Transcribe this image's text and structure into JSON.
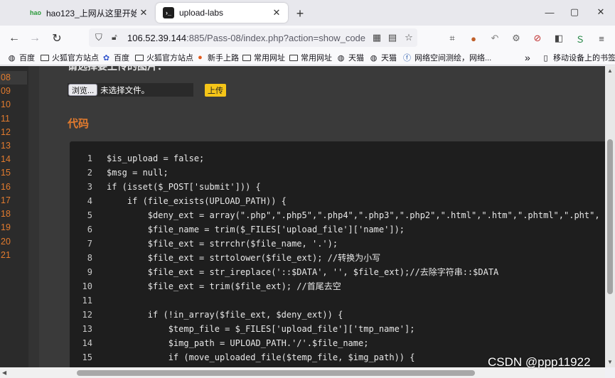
{
  "tabs": [
    {
      "title": "hao123_上网从这里开始",
      "favicon": "hao-favicon"
    },
    {
      "title": "upload-labs",
      "favicon": "terminal-favicon",
      "active": true
    }
  ],
  "nav": {
    "url_host": "106.52.39.144",
    "url_rest": ":885/Pass-08/index.php?action=show_code"
  },
  "bookmarks": [
    {
      "label": "百度",
      "icon": "globe-icon"
    },
    {
      "label": "火狐官方站点",
      "icon": "folder-icon"
    },
    {
      "label": "百度",
      "icon": "paw-icon"
    },
    {
      "label": "火狐官方站点",
      "icon": "folder-icon"
    },
    {
      "label": "新手上路",
      "icon": "firefox-icon"
    },
    {
      "label": "常用网址",
      "icon": "folder-icon"
    },
    {
      "label": "常用网址",
      "icon": "folder-icon"
    },
    {
      "label": "天猫",
      "icon": "globe-icon"
    },
    {
      "label": "天猫",
      "icon": "globe-icon"
    },
    {
      "label": "网络空间测绘，网络...",
      "icon": "map-icon"
    }
  ],
  "bookmarks_overflow": "»",
  "bookmarks_mobile": "移动设备上的书签",
  "gutter_lines": [
    "08",
    "09",
    "10",
    "11",
    "12",
    "13",
    "14",
    "15",
    "16",
    "17",
    "18",
    "19",
    "20",
    "21"
  ],
  "page": {
    "cut_heading": "请选择要上传的图片：",
    "browse_label": "浏览...",
    "no_file_text": "未选择文件。",
    "upload_label": "上传",
    "section_title": "代码"
  },
  "code_lines": [
    {
      "n": "1",
      "text": "$is_upload = false;"
    },
    {
      "n": "2",
      "text": "$msg = null;"
    },
    {
      "n": "3",
      "text": "if (isset($_POST['submit'])) {"
    },
    {
      "n": "4",
      "text": "    if (file_exists(UPLOAD_PATH)) {"
    },
    {
      "n": "5",
      "text": "        $deny_ext = array(\".php\",\".php5\",\".php4\",\".php3\",\".php2\",\".html\",\".htm\",\".phtml\",\".pht\","
    },
    {
      "n": "6",
      "text": "        $file_name = trim($_FILES['upload_file']['name']);"
    },
    {
      "n": "7",
      "text": "        $file_ext = strrchr($file_name, '.');"
    },
    {
      "n": "8",
      "text": "        $file_ext = strtolower($file_ext); //转换为小写"
    },
    {
      "n": "9",
      "text": "        $file_ext = str_ireplace('::$DATA', '', $file_ext);//去除字符串::$DATA"
    },
    {
      "n": "10",
      "text": "        $file_ext = trim($file_ext); //首尾去空"
    },
    {
      "n": "11",
      "text": ""
    },
    {
      "n": "12",
      "text": "        if (!in_array($file_ext, $deny_ext)) {"
    },
    {
      "n": "13",
      "text": "            $temp_file = $_FILES['upload_file']['tmp_name'];"
    },
    {
      "n": "14",
      "text": "            $img_path = UPLOAD_PATH.'/'.$file_name;"
    },
    {
      "n": "15",
      "text": "            if (move_uploaded_file($temp_file, $img_path)) {"
    }
  ],
  "watermark": "CSDN @ppp11922",
  "colors": {
    "accent": "#e27b2e",
    "upload_button": "#f5c518",
    "code_bg": "#1e1e1e",
    "page_bg": "#3a3a3a"
  }
}
